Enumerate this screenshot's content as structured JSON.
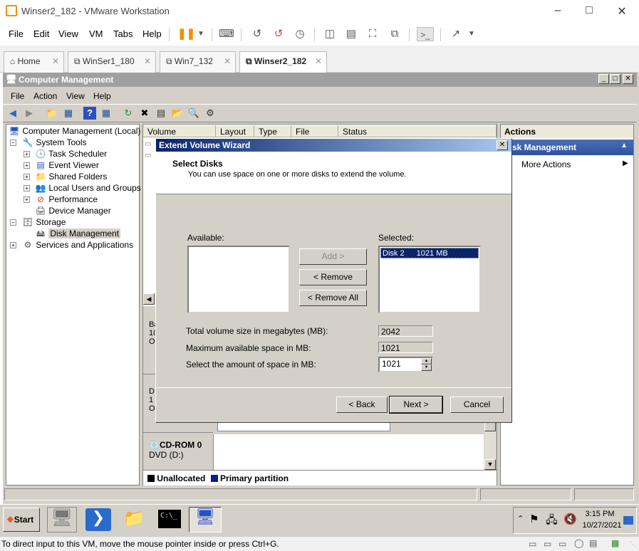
{
  "vmware": {
    "title": "Winser2_182 - VMware Workstation",
    "menu": [
      "File",
      "Edit",
      "View",
      "VM",
      "Tabs",
      "Help"
    ],
    "tabs": [
      {
        "label": "Home"
      },
      {
        "label": "WinSer1_180"
      },
      {
        "label": "Win7_132"
      },
      {
        "label": "Winser2_182",
        "active": true
      }
    ],
    "status_text": "To direct input to this VM, move the mouse pointer inside or press Ctrl+G."
  },
  "cm": {
    "title": "Computer Management",
    "menu": [
      "File",
      "Action",
      "View",
      "Help"
    ],
    "tree": [
      {
        "label": "Computer Management (Local)",
        "level": 0,
        "icon": "computer-icon"
      },
      {
        "label": "System Tools",
        "level": 1,
        "expander": "-",
        "icon": "tools-icon"
      },
      {
        "label": "Task Scheduler",
        "level": 2,
        "expander": "+",
        "icon": "clock-icon"
      },
      {
        "label": "Event Viewer",
        "level": 2,
        "expander": "+",
        "icon": "event-icon"
      },
      {
        "label": "Shared Folders",
        "level": 2,
        "expander": "+",
        "icon": "folder-icon"
      },
      {
        "label": "Local Users and Groups",
        "level": 2,
        "expander": "+",
        "icon": "users-icon"
      },
      {
        "label": "Performance",
        "level": 2,
        "expander": "+",
        "icon": "performance-icon"
      },
      {
        "label": "Device Manager",
        "level": 2,
        "icon": "device-icon"
      },
      {
        "label": "Storage",
        "level": 1,
        "expander": "-",
        "icon": "storage-icon"
      },
      {
        "label": "Disk Management",
        "level": 2,
        "icon": "disk-icon",
        "selected": true
      },
      {
        "label": "Services and Applications",
        "level": 1,
        "expander": "+",
        "icon": "services-icon"
      }
    ],
    "columns": [
      "Volume",
      "Layout",
      "Type",
      "File System",
      "Status"
    ],
    "cdrom": {
      "name": "CD-ROM 0",
      "drive": "DVD (D:)"
    },
    "legend": {
      "unallocated": "Unallocated",
      "primary": "Primary partition"
    },
    "actions": {
      "header": "Actions",
      "section": "sk Management",
      "more": "More Actions"
    }
  },
  "wizard": {
    "title": "Extend Volume Wizard",
    "heading": "Select Disks",
    "subheading": "You can use space on one or more disks to extend the volume.",
    "available_label": "Available:",
    "selected_label": "Selected:",
    "selected_item": {
      "disk": "Disk 2",
      "size": "1021 MB"
    },
    "add_btn": "Add >",
    "remove_btn": "< Remove",
    "remove_all_btn": "< Remove All",
    "total_label": "Total volume size in megabytes (MB):",
    "total_value": "2042",
    "max_label": "Maximum available space in MB:",
    "max_value": "1021",
    "amount_label": "Select the amount of space in MB:",
    "amount_value": "1021",
    "back_btn": "< Back",
    "next_btn": "Next >",
    "cancel_btn": "Cancel"
  },
  "taskbar": {
    "start": "Start",
    "time": "3:15 PM",
    "date": "10/27/2021"
  }
}
